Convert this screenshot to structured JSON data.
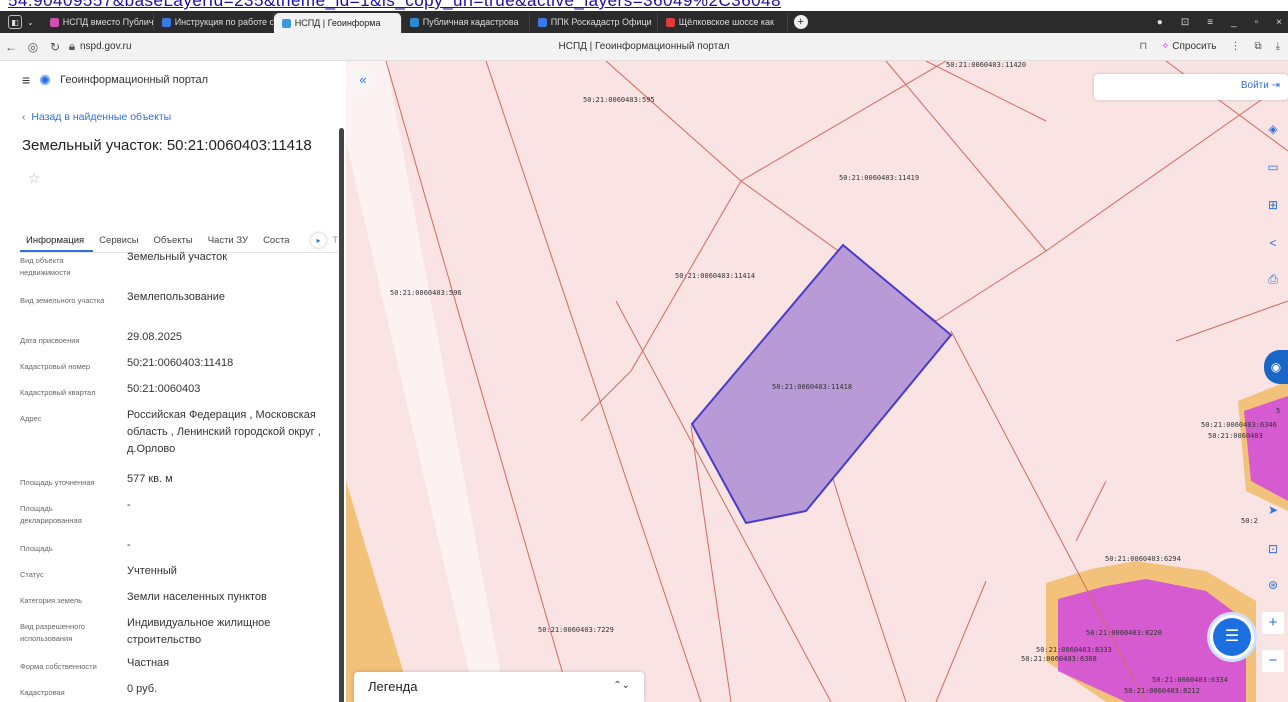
{
  "url_overflow_text": "54.90409557&baseLayerId=235&theme_id=1&is_copy_url=true&active_layers=36049%2C36048",
  "browser": {
    "tabs": [
      {
        "label": "НСПД вместо Публично",
        "color": "#d04fb0",
        "active": false
      },
      {
        "label": "Инструкция по работе с",
        "color": "#3a78e8",
        "active": false
      },
      {
        "label": "НСПД | Геоинформа",
        "color": "#3a9ae0",
        "active": true
      },
      {
        "label": "Публичная кадастрова",
        "color": "#2e8ad0",
        "active": false
      },
      {
        "label": "ППК Роскадастр Офици",
        "color": "#3a78e8",
        "active": false
      },
      {
        "label": "Щёлковское шоссе как",
        "color": "#e03a3a",
        "active": false
      }
    ],
    "new_tab": "+",
    "url": "nspd.gov.ru",
    "page_title": "НСПД | Геоинформационный портал",
    "ask_label": "Спросить"
  },
  "sidebar": {
    "app_title": "Геоинформационный портал",
    "back_link": "Назад в найденные объекты",
    "title": "Земельный участок: 50:21:0060403:11418",
    "tabs": [
      {
        "label": "Информация",
        "active": true
      },
      {
        "label": "Сервисы",
        "active": false
      },
      {
        "label": "Объекты",
        "active": false
      },
      {
        "label": "Части ЗУ",
        "active": false
      },
      {
        "label": "Соста",
        "active": false
      }
    ],
    "tabs_cut": "Т",
    "properties": [
      {
        "label": "Вид объекта недвижимости",
        "value": "Земельный участок"
      },
      {
        "label": "Вид земельного участка",
        "value": "Землепользование"
      },
      {
        "label": "Дата присвоения",
        "value": "29.08.2025"
      },
      {
        "label": "Кадастровый номер",
        "value": "50:21:0060403:11418"
      },
      {
        "label": "Кадастровый квартал",
        "value": "50:21:0060403"
      },
      {
        "label": "Адрес",
        "value": "Российская Федерация , Московская область , Ленинский городской округ , д.Орлово"
      },
      {
        "label": "Площадь уточненная",
        "value": "577 кв. м"
      },
      {
        "label": "Площадь декларированная",
        "value": "-"
      },
      {
        "label": "Площадь",
        "value": "-"
      },
      {
        "label": "Статус",
        "value": "Учтенный"
      },
      {
        "label": "Категория земель",
        "value": "Земли населенных пунктов"
      },
      {
        "label": "Вид разрешенного использования",
        "value": "Индивидуальное жилищное строительство"
      },
      {
        "label": "Форма собственности",
        "value": "Частная"
      },
      {
        "label": "Кадастровая",
        "value": "0 руб."
      }
    ]
  },
  "map": {
    "login_label": "Войти",
    "legend_label": "Легенда",
    "parcel_labels": [
      "50:21:0060403:11420",
      "50:21:0060403:595",
      "50:21:0060403:11419",
      "50:21:0060403:11414",
      "50:21:0060403:596",
      "50:21:0060403:11418",
      "50:21:0060403:7229",
      "50:21:0060403:6294",
      "50:21:0060403:8220",
      "50:21:0060403:8333",
      "50:21:0060403:6368",
      "50:21:0060403:6334",
      "50:21:0060403:8212",
      "50:21:0060403:6346",
      "50:21:0060403",
      "50:2",
      "5"
    ],
    "colors": {
      "background": "#f9e3e3",
      "boundary": "#d06a5e",
      "selected_fill": "#b89ad6",
      "selected_stroke": "#4a3cc8",
      "magenta_fill": "#d65ad0",
      "orange_fill": "#f3c27a"
    }
  }
}
